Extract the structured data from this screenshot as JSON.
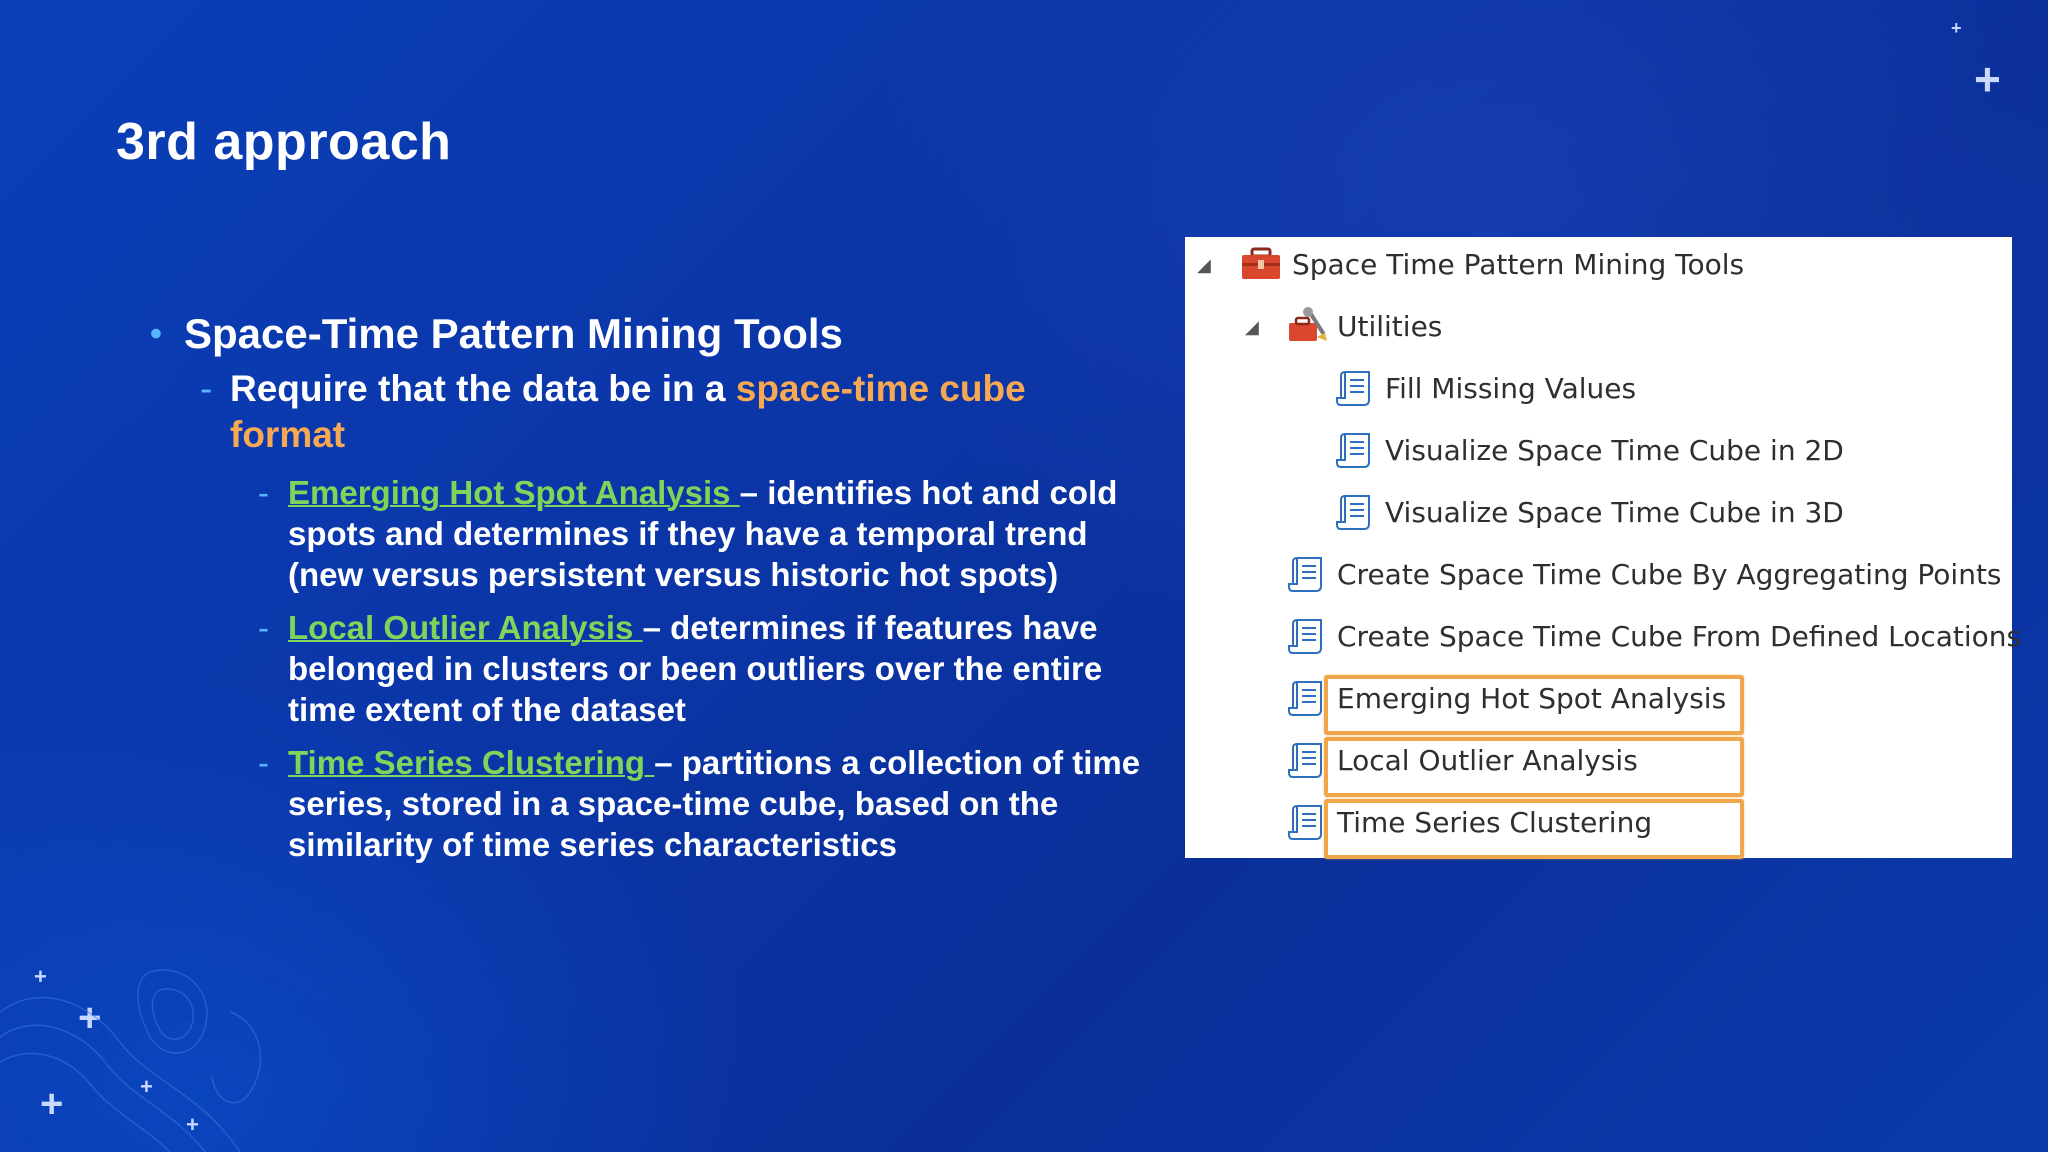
{
  "slide": {
    "title": "3rd approach",
    "bullet_main": "Space-Time Pattern Mining Tools",
    "sub_prefix": "Require that the data be in a",
    "sub_highlight": "space-time cube",
    "sub_highlight_2": "format",
    "items": [
      {
        "name": "Emerging Hot Spot Analysis ",
        "desc": "– identifies hot and cold spots and determines if they have a temporal trend (new versus persistent versus historic hot spots)"
      },
      {
        "name": "Local Outlier Analysis ",
        "desc": "– determines if features have belonged in clusters or been outliers over the entire time extent of the dataset"
      },
      {
        "name": "Time Series Clustering ",
        "desc": "– partitions a collection of time series, stored in a space-time cube, based on the similarity of time series characteristics"
      }
    ]
  },
  "toolbox": {
    "root": "Space Time Pattern Mining Tools",
    "utilities": "Utilities",
    "utility_tools": [
      "Fill Missing Values",
      "Visualize Space Time Cube in 2D",
      "Visualize Space Time Cube in 3D"
    ],
    "tools": [
      "Create Space Time Cube By Aggregating Points",
      "Create Space Time Cube From Defined Locations",
      "Emerging Hot Spot Analysis",
      "Local Outlier Analysis",
      "Time Series Clustering"
    ],
    "highlight_color": "#f0a64a"
  },
  "colors": {
    "accent_orange": "#f6a852",
    "link_green": "#7fd45a",
    "bullet_blue": "#58b5ff"
  }
}
